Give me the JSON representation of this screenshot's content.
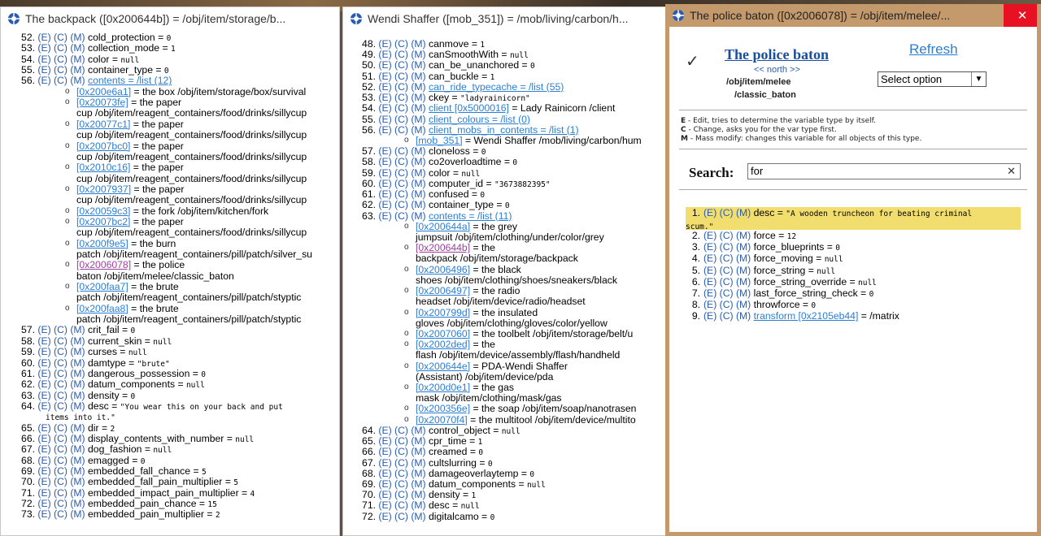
{
  "win1": {
    "title": "The backpack ([0x200644b]) = /obj/item/storage/b...",
    "rows": [
      {
        "type": "var",
        "n": "52.",
        "name": "cold_protection",
        "eq": " = ",
        "val": "0",
        "vk": "s"
      },
      {
        "type": "var",
        "n": "53.",
        "name": "collection_mode",
        "eq": " = ",
        "val": "1",
        "vk": "s"
      },
      {
        "type": "var",
        "n": "54.",
        "name": "color",
        "eq": " = ",
        "val": "null",
        "vk": "s"
      },
      {
        "type": "var",
        "n": "55.",
        "name": "container_type",
        "eq": " = ",
        "val": "0",
        "vk": "s"
      },
      {
        "type": "var",
        "n": "56.",
        "name": "contents = /list (12)",
        "eq": "",
        "val": "",
        "vk": "link"
      },
      {
        "type": "item",
        "ref": "[0x200e6a1]",
        "text": " = the box /obj/item/storage/box/survival"
      },
      {
        "type": "item",
        "ref": "[0x20073fe]",
        "text": " = the paper"
      },
      {
        "type": "cont",
        "text": "cup /obj/item/reagent_containers/food/drinks/sillycup"
      },
      {
        "type": "item",
        "ref": "[0x20077c1]",
        "text": " = the paper"
      },
      {
        "type": "cont",
        "text": "cup /obj/item/reagent_containers/food/drinks/sillycup"
      },
      {
        "type": "item",
        "ref": "[0x2007bc0]",
        "text": " = the paper"
      },
      {
        "type": "cont",
        "text": "cup /obj/item/reagent_containers/food/drinks/sillycup"
      },
      {
        "type": "item",
        "ref": "[0x2010c16]",
        "text": " = the paper"
      },
      {
        "type": "cont",
        "text": "cup /obj/item/reagent_containers/food/drinks/sillycup"
      },
      {
        "type": "item",
        "ref": "[0x2007937]",
        "text": " = the paper"
      },
      {
        "type": "cont",
        "text": "cup /obj/item/reagent_containers/food/drinks/sillycup"
      },
      {
        "type": "item",
        "ref": "[0x20059c3]",
        "text": " = the fork /obj/item/kitchen/fork"
      },
      {
        "type": "item",
        "ref": "[0x2007bc2]",
        "text": " = the paper"
      },
      {
        "type": "cont",
        "text": "cup /obj/item/reagent_containers/food/drinks/sillycup"
      },
      {
        "type": "item",
        "ref": "[0x200f9e5]",
        "text": " = the burn"
      },
      {
        "type": "cont",
        "text": "patch /obj/item/reagent_containers/pill/patch/silver_su"
      },
      {
        "type": "item",
        "ref": "[0x2006078]",
        "text": " = the police",
        "visited": true
      },
      {
        "type": "cont",
        "text": "baton /obj/item/melee/classic_baton"
      },
      {
        "type": "item",
        "ref": "[0x200faa7]",
        "text": " = the brute"
      },
      {
        "type": "cont",
        "text": "patch /obj/item/reagent_containers/pill/patch/styptic"
      },
      {
        "type": "item",
        "ref": "[0x200faa8]",
        "text": " = the brute"
      },
      {
        "type": "cont",
        "text": "patch /obj/item/reagent_containers/pill/patch/styptic"
      },
      {
        "type": "var",
        "n": "57.",
        "name": "crit_fail",
        "eq": " = ",
        "val": "0",
        "vk": "s"
      },
      {
        "type": "var",
        "n": "58.",
        "name": "current_skin",
        "eq": " = ",
        "val": "null",
        "vk": "s"
      },
      {
        "type": "var",
        "n": "59.",
        "name": "curses",
        "eq": " = ",
        "val": "null",
        "vk": "s"
      },
      {
        "type": "var",
        "n": "60.",
        "name": "damtype",
        "eq": " = ",
        "val": "\"brute\"",
        "vk": "s"
      },
      {
        "type": "var",
        "n": "61.",
        "name": "dangerous_possession",
        "eq": " = ",
        "val": "0",
        "vk": "s"
      },
      {
        "type": "var",
        "n": "62.",
        "name": "datum_components",
        "eq": " = ",
        "val": "null",
        "vk": "s"
      },
      {
        "type": "var",
        "n": "63.",
        "name": "density",
        "eq": " = ",
        "val": "0",
        "vk": "s"
      },
      {
        "type": "var",
        "n": "64.",
        "name": "desc",
        "eq": " = ",
        "val": "\"You wear this on your back and put",
        "vk": "s"
      },
      {
        "type": "contmono",
        "text": "items into it.\""
      },
      {
        "type": "var",
        "n": "65.",
        "name": "dir",
        "eq": " = ",
        "val": "2",
        "vk": "s"
      },
      {
        "type": "var",
        "n": "66.",
        "name": "display_contents_with_number",
        "eq": " = ",
        "val": "null",
        "vk": "s"
      },
      {
        "type": "var",
        "n": "67.",
        "name": "dog_fashion",
        "eq": " = ",
        "val": "null",
        "vk": "s"
      },
      {
        "type": "var",
        "n": "68.",
        "name": "emagged",
        "eq": " = ",
        "val": "0",
        "vk": "s"
      },
      {
        "type": "var",
        "n": "69.",
        "name": "embedded_fall_chance",
        "eq": " = ",
        "val": "5",
        "vk": "s"
      },
      {
        "type": "var",
        "n": "70.",
        "name": "embedded_fall_pain_multiplier",
        "eq": " = ",
        "val": "5",
        "vk": "s"
      },
      {
        "type": "var",
        "n": "71.",
        "name": "embedded_impact_pain_multiplier",
        "eq": " = ",
        "val": "4",
        "vk": "s"
      },
      {
        "type": "var",
        "n": "72.",
        "name": "embedded_pain_chance",
        "eq": " = ",
        "val": "15",
        "vk": "s"
      },
      {
        "type": "var",
        "n": "73.",
        "name": "embedded_pain_multiplier",
        "eq": " = ",
        "val": "2",
        "vk": "s"
      }
    ]
  },
  "win2": {
    "title": "Wendi Shaffer ([mob_351]) = /mob/living/carbon/h...",
    "rows": [
      {
        "type": "var",
        "n": "48.",
        "name": "canmove",
        "eq": " = ",
        "val": "1",
        "vk": "s"
      },
      {
        "type": "var",
        "n": "49.",
        "name": "canSmoothWith",
        "eq": " = ",
        "val": "null",
        "vk": "s"
      },
      {
        "type": "var",
        "n": "50.",
        "name": "can_be_unanchored",
        "eq": " = ",
        "val": "0",
        "vk": "s"
      },
      {
        "type": "var",
        "n": "51.",
        "name": "can_buckle",
        "eq": " = ",
        "val": "1",
        "vk": "s"
      },
      {
        "type": "var",
        "n": "52.",
        "name": "can_ride_typecache = /list (55)",
        "eq": "",
        "val": "",
        "vk": "link"
      },
      {
        "type": "var",
        "n": "53.",
        "name": "ckey",
        "eq": " = ",
        "val": "\"ladyrainicorn\"",
        "vk": "s"
      },
      {
        "type": "var",
        "n": "54.",
        "name": "client [0x5000016]",
        "eq": "",
        "val": " = Lady Rainicorn /client",
        "vk": "linkt"
      },
      {
        "type": "var",
        "n": "55.",
        "name": "client_colours = /list (0)",
        "eq": "",
        "val": "",
        "vk": "link"
      },
      {
        "type": "var",
        "n": "56.",
        "name": "client_mobs_in_contents = /list (1)",
        "eq": "",
        "val": "",
        "vk": "link"
      },
      {
        "type": "item",
        "ref": "[mob_351]",
        "text": " = Wendi Shaffer /mob/living/carbon/hum"
      },
      {
        "type": "var",
        "n": "57.",
        "name": "cloneloss",
        "eq": " = ",
        "val": "0",
        "vk": "s"
      },
      {
        "type": "var",
        "n": "58.",
        "name": "co2overloadtime",
        "eq": " = ",
        "val": "0",
        "vk": "s"
      },
      {
        "type": "var",
        "n": "59.",
        "name": "color",
        "eq": " = ",
        "val": "null",
        "vk": "s"
      },
      {
        "type": "var",
        "n": "60.",
        "name": "computer_id",
        "eq": " = ",
        "val": "\"3673882395\"",
        "vk": "s"
      },
      {
        "type": "var",
        "n": "61.",
        "name": "confused",
        "eq": " = ",
        "val": "0",
        "vk": "s"
      },
      {
        "type": "var",
        "n": "62.",
        "name": "container_type",
        "eq": " = ",
        "val": "0",
        "vk": "s"
      },
      {
        "type": "var",
        "n": "63.",
        "name": "contents = /list (11)",
        "eq": "",
        "val": "",
        "vk": "link"
      },
      {
        "type": "item",
        "ref": "[0x200644a]",
        "text": " = the grey"
      },
      {
        "type": "cont",
        "text": "jumpsuit /obj/item/clothing/under/color/grey"
      },
      {
        "type": "item",
        "ref": "[0x200644b]",
        "text": " = the",
        "visited": true
      },
      {
        "type": "cont",
        "text": "backpack /obj/item/storage/backpack"
      },
      {
        "type": "item",
        "ref": "[0x2006496]",
        "text": " = the black"
      },
      {
        "type": "cont",
        "text": "shoes /obj/item/clothing/shoes/sneakers/black"
      },
      {
        "type": "item",
        "ref": "[0x2006497]",
        "text": " = the radio"
      },
      {
        "type": "cont",
        "text": "headset /obj/item/device/radio/headset"
      },
      {
        "type": "item",
        "ref": "[0x200799d]",
        "text": " = the insulated"
      },
      {
        "type": "cont",
        "text": "gloves /obj/item/clothing/gloves/color/yellow"
      },
      {
        "type": "item",
        "ref": "[0x2007060]",
        "text": " = the toolbelt /obj/item/storage/belt/u"
      },
      {
        "type": "item",
        "ref": "[0x2002ded]",
        "text": " = the"
      },
      {
        "type": "cont",
        "text": "flash /obj/item/device/assembly/flash/handheld"
      },
      {
        "type": "item",
        "ref": "[0x200644e]",
        "text": " = PDA-Wendi Shaffer"
      },
      {
        "type": "cont",
        "text": "(Assistant) /obj/item/device/pda"
      },
      {
        "type": "item",
        "ref": "[0x200d0e1]",
        "text": " = the gas"
      },
      {
        "type": "cont",
        "text": "mask /obj/item/clothing/mask/gas"
      },
      {
        "type": "item",
        "ref": "[0x200356e]",
        "text": " = the soap /obj/item/soap/nanotrasen"
      },
      {
        "type": "item",
        "ref": "[0x20070f4]",
        "text": " = the multitool /obj/item/device/multito"
      },
      {
        "type": "var",
        "n": "64.",
        "name": "control_object",
        "eq": " = ",
        "val": "null",
        "vk": "s"
      },
      {
        "type": "var",
        "n": "65.",
        "name": "cpr_time",
        "eq": " = ",
        "val": "1",
        "vk": "s"
      },
      {
        "type": "var",
        "n": "66.",
        "name": "creamed",
        "eq": " = ",
        "val": "0",
        "vk": "s"
      },
      {
        "type": "var",
        "n": "67.",
        "name": "cultslurring",
        "eq": " = ",
        "val": "0",
        "vk": "s"
      },
      {
        "type": "var",
        "n": "68.",
        "name": "damageoverlaytemp",
        "eq": " = ",
        "val": "0",
        "vk": "s"
      },
      {
        "type": "var",
        "n": "69.",
        "name": "datum_components",
        "eq": " = ",
        "val": "null",
        "vk": "s"
      },
      {
        "type": "var",
        "n": "70.",
        "name": "density",
        "eq": " = ",
        "val": "1",
        "vk": "s"
      },
      {
        "type": "var",
        "n": "71.",
        "name": "desc",
        "eq": " = ",
        "val": "null",
        "vk": "s"
      },
      {
        "type": "var",
        "n": "72.",
        "name": "digitalcamo",
        "eq": " = ",
        "val": "0",
        "vk": "s"
      }
    ]
  },
  "win3": {
    "title": "The police baton ([0x2006078]) = /obj/item/melee/...",
    "close": "✕",
    "check": "✓",
    "obj_name": "The police baton",
    "nav": "<< north >>",
    "path1": "/obj/item/melee",
    "path2": "/classic_baton",
    "refresh": "Refresh",
    "select_value": "Select option",
    "legend": [
      {
        "key": "E",
        "text": " - Edit, tries to determine the variable type by itself."
      },
      {
        "key": "C",
        "text": " - Change, asks you for the var type first."
      },
      {
        "key": "M",
        "text": " - Mass modify: changes this variable for all objects of this type."
      }
    ],
    "search_label": "Search:",
    "search_value": "for",
    "search_clear": "✕",
    "ecm": [
      "(E)",
      "(C)",
      "(M)"
    ],
    "rows": [
      {
        "n": "1.",
        "name": "desc",
        "eq": " = ",
        "val": "\"A wooden truncheon for beating criminal",
        "val2": "scum.\"",
        "mono": true,
        "hl": true
      },
      {
        "n": "2.",
        "name": "force",
        "eq": " = ",
        "val": "12"
      },
      {
        "n": "3.",
        "name": "force_blueprints",
        "eq": " = ",
        "val": "0"
      },
      {
        "n": "4.",
        "name": "force_moving",
        "eq": " = ",
        "val": "null"
      },
      {
        "n": "5.",
        "name": "force_string",
        "eq": " = ",
        "val": "null"
      },
      {
        "n": "6.",
        "name": "force_string_override",
        "eq": " = ",
        "val": "null"
      },
      {
        "n": "7.",
        "name": "last_force_string_check",
        "eq": " = ",
        "val": "0"
      },
      {
        "n": "8.",
        "name": "throwforce",
        "eq": " = ",
        "val": "0"
      },
      {
        "n": "9.",
        "name": "transform [0x2105eb44]",
        "eq": "",
        "val": " = /matrix",
        "link": true
      }
    ]
  }
}
